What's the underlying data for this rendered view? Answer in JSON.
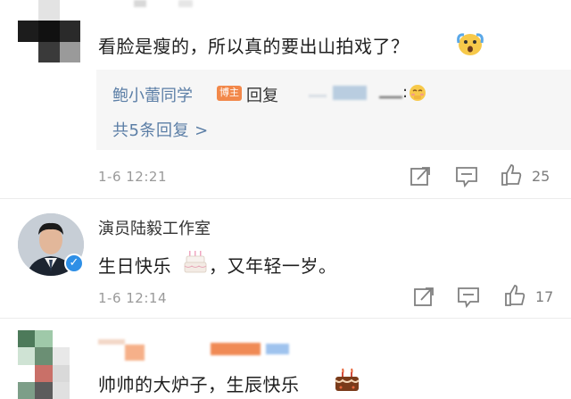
{
  "comments": [
    {
      "text": "看脸是瘦的，所以真的要出山拍戏了？",
      "reply_preview": {
        "name": "鲍小蕾同学",
        "badge": "博主",
        "verb": "回复",
        "suffix": ":"
      },
      "reply_count_label": "共5条回复 >",
      "timestamp": "1-6 12:21",
      "likes": "25"
    },
    {
      "username": "演员陆毅工作室",
      "text_before": "生日快乐",
      "text_after": "，又年轻一岁。",
      "timestamp": "1-6 12:14",
      "likes": "17"
    },
    {
      "text": "帅帅的大炉子，生辰快乐"
    }
  ],
  "icons": [
    "share-icon",
    "comment-icon",
    "like-icon",
    "verified-icon",
    "cake-icon",
    "surprised-emoji-icon",
    "shy-emoji-icon"
  ],
  "colors": {
    "link": "#5b7ea6",
    "badge": "#f2884a",
    "verified": "#2e8fe6",
    "timestamp": "#9a9a9a"
  }
}
